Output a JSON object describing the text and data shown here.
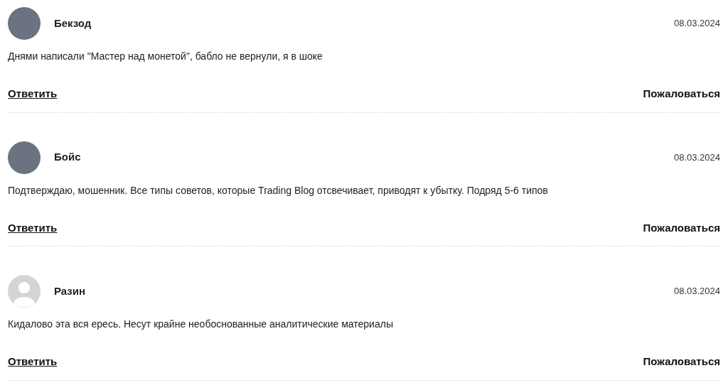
{
  "comments": [
    {
      "author": "Бекзод",
      "kind": "photo",
      "date": "08.03.2024",
      "text": "Днями написали \"Мастер над монетой\", бабло не вернули, я в шоке",
      "reply": "Ответить",
      "report": "Пожаловаться"
    },
    {
      "author": "Бойс",
      "kind": "photo",
      "date": "08.03.2024",
      "text": "Подтверждаю, мошенник. Все типы советов, которые Trading Blog отсвечивает, приводят к убытку. Подряд 5-6 типов",
      "reply": "Ответить",
      "report": "Пожаловаться"
    },
    {
      "author": "Разин",
      "kind": "default",
      "date": "08.03.2024",
      "text": "Кидалово эта вся ересь. Несут крайне необоснованные аналитические материалы",
      "reply": "Ответить",
      "report": "Пожаловаться"
    }
  ]
}
